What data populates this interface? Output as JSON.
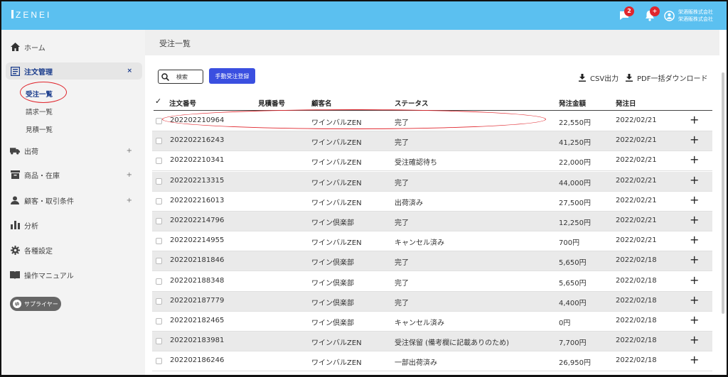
{
  "header": {
    "logo": "ZENEI",
    "messages_badge": "2",
    "notifications_badge": "+",
    "company_line1": "栄酒販株式会社",
    "company_line2": "栄酒販株式会社"
  },
  "sidebar": {
    "home": "ホーム",
    "order_mgmt": "注文管理",
    "order_mgmt_close": "×",
    "sub_orders": "受注一覧",
    "sub_invoices": "請求一覧",
    "sub_quotes": "見積一覧",
    "shipping": "出荷",
    "products": "商品・在庫",
    "customers": "顧客・取引条件",
    "analytics": "分析",
    "settings": "各種設定",
    "manual": "操作マニュアル",
    "plus": "+",
    "supplier": "サプライヤー"
  },
  "main": {
    "breadcrumb": "受注一覧",
    "search_label": "検索",
    "manual_register": "手動受注登録",
    "csv_export": "CSV出力",
    "pdf_download": "PDF一括ダウンロード"
  },
  "table": {
    "headers": {
      "check": "✓",
      "order_no": "注文番号",
      "quote_no": "見積番号",
      "customer": "顧客名",
      "status": "ステータス",
      "amount": "発注金額",
      "date": "発注日"
    },
    "rows": [
      {
        "order_no": "202202210964",
        "quote_no": "",
        "customer": "ワインバルZEN",
        "status": "完了",
        "amount": "22,550円",
        "date": "2022/02/21"
      },
      {
        "order_no": "202202216243",
        "quote_no": "",
        "customer": "ワインバルZEN",
        "status": "完了",
        "amount": "41,250円",
        "date": "2022/02/21"
      },
      {
        "order_no": "202202210341",
        "quote_no": "",
        "customer": "ワインバルZEN",
        "status": "受注確認待ち",
        "amount": "22,000円",
        "date": "2022/02/21"
      },
      {
        "order_no": "202202213315",
        "quote_no": "",
        "customer": "ワインバルZEN",
        "status": "完了",
        "amount": "44,000円",
        "date": "2022/02/21"
      },
      {
        "order_no": "202202216013",
        "quote_no": "",
        "customer": "ワインバルZEN",
        "status": "出荷済み",
        "amount": "27,500円",
        "date": "2022/02/21"
      },
      {
        "order_no": "202202214796",
        "quote_no": "",
        "customer": "ワイン倶楽部",
        "status": "完了",
        "amount": "12,250円",
        "date": "2022/02/21"
      },
      {
        "order_no": "202202214955",
        "quote_no": "",
        "customer": "ワインバルZEN",
        "status": "キャンセル済み",
        "amount": "700円",
        "date": "2022/02/21"
      },
      {
        "order_no": "202202181846",
        "quote_no": "",
        "customer": "ワイン倶楽部",
        "status": "完了",
        "amount": "5,650円",
        "date": "2022/02/18"
      },
      {
        "order_no": "202202188348",
        "quote_no": "",
        "customer": "ワイン倶楽部",
        "status": "完了",
        "amount": "5,650円",
        "date": "2022/02/18"
      },
      {
        "order_no": "202202187779",
        "quote_no": "",
        "customer": "ワイン倶楽部",
        "status": "完了",
        "amount": "4,400円",
        "date": "2022/02/18"
      },
      {
        "order_no": "202202182465",
        "quote_no": "",
        "customer": "ワイン倶楽部",
        "status": "キャンセル済み",
        "amount": "0円",
        "date": "2022/02/18"
      },
      {
        "order_no": "202202183981",
        "quote_no": "",
        "customer": "ワインバルZEN",
        "status": "受注保留 (備考欄に記載ありのため)",
        "amount": "7,700円",
        "date": "2022/02/18"
      },
      {
        "order_no": "202202186246",
        "quote_no": "",
        "customer": "ワインバルZEN",
        "status": "一部出荷済み",
        "amount": "26,950円",
        "date": "2022/02/18"
      }
    ],
    "row_action": "+"
  }
}
